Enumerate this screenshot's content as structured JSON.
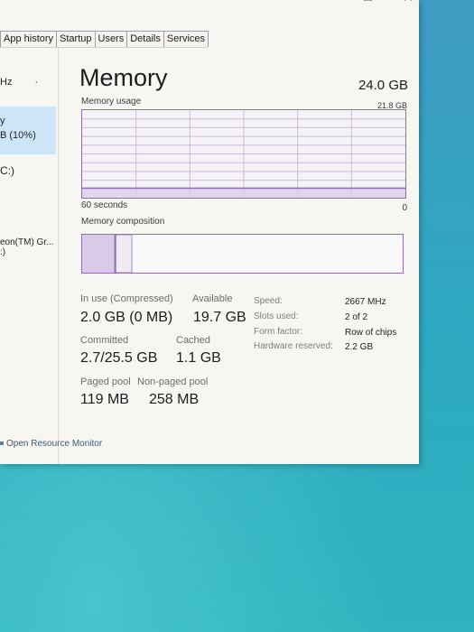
{
  "window": {
    "caption_buttons": {
      "minimize": "—",
      "maximize": "□",
      "close": "✕"
    },
    "tabs": [
      "App history",
      "Startup",
      "Users",
      "Details",
      "Services"
    ]
  },
  "left_pane": {
    "items": [
      {
        "text": "Hz"
      },
      {
        "text": "y"
      },
      {
        "text": "B (10%)"
      },
      {
        "text": "C:)"
      },
      {
        "text": "eon(TM) Gr..."
      },
      {
        "text": ":)"
      }
    ]
  },
  "memory": {
    "title": "Memory",
    "total": "24.0 GB",
    "usage_label": "Memory usage",
    "graph_max": "21.8 GB",
    "time_label": "60 seconds",
    "axis_zero": "0",
    "composition_label": "Memory composition",
    "usage_level": 0.11,
    "composition_segments": {
      "in_use_fraction": 0.1,
      "modified_fraction": 0.005,
      "standby_fraction": 0.05
    }
  },
  "stats": {
    "in_use_label": "In use (Compressed)",
    "in_use_value": "2.0 GB (0 MB)",
    "available_label": "Available",
    "available_value": "19.7 GB",
    "committed_label": "Committed",
    "committed_value": "2.7/25.5 GB",
    "cached_label": "Cached",
    "cached_value": "1.1 GB",
    "paged_label": "Paged pool",
    "paged_value": "119 MB",
    "nonpaged_label": "Non-paged pool",
    "nonpaged_value": "258 MB"
  },
  "specs": {
    "speed_label": "Speed:",
    "speed_value": "2667 MHz",
    "slots_label": "Slots used:",
    "slots_value": "2 of 2",
    "form_label": "Form factor:",
    "form_value": "Row of chips",
    "reserved_label": "Hardware reserved:",
    "reserved_value": "2.2 GB"
  },
  "footer": {
    "resource_monitor": "Open Resource Monitor"
  },
  "colors": {
    "accent": "#8f6fb1",
    "graph_fill": "#d9cbe7",
    "grid": "#c9bcd8",
    "selected": "#cde6f7",
    "desktop": "#2fb0c8"
  }
}
